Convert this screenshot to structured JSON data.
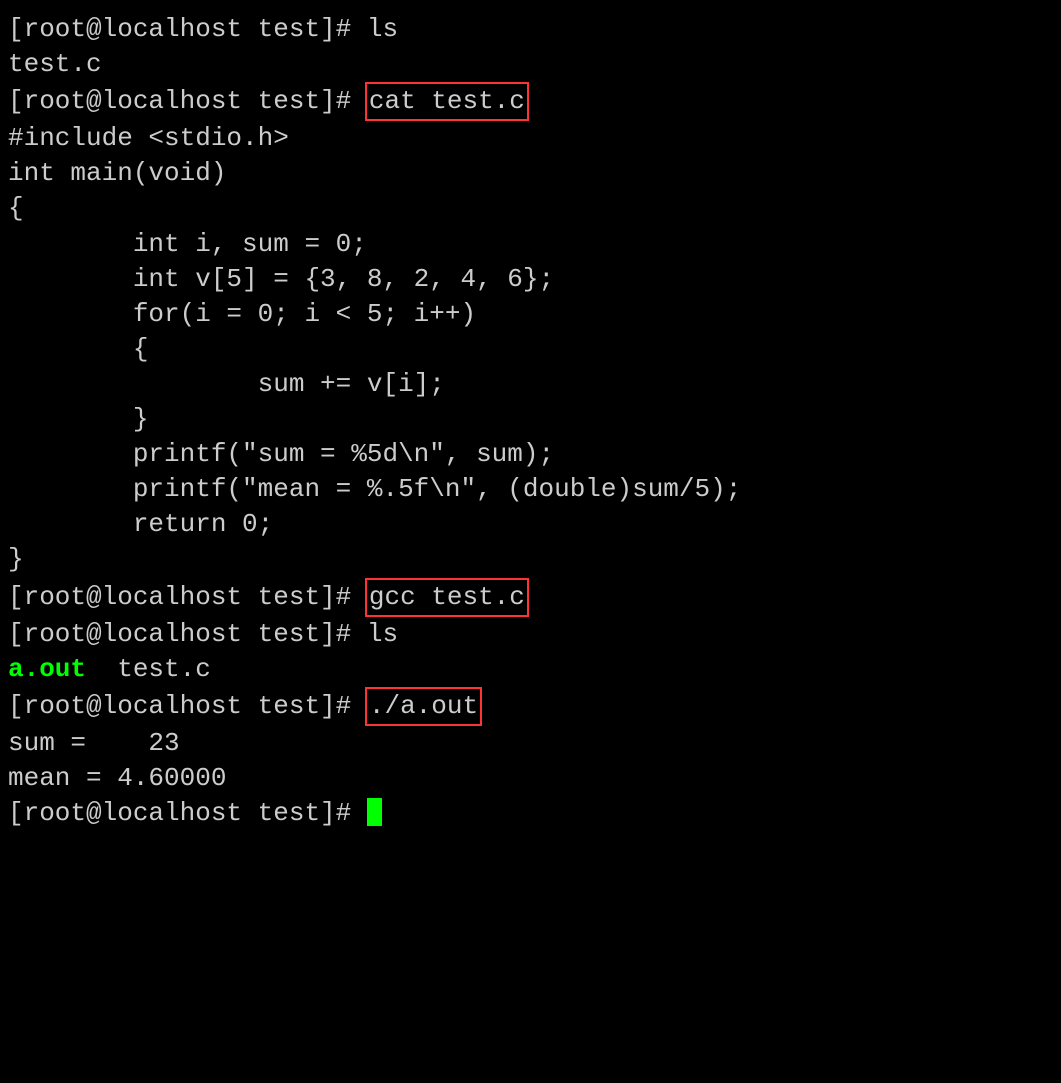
{
  "prompt": "[root@localhost test]# ",
  "cmd": {
    "ls1": "ls",
    "cat": "cat test.c",
    "gcc": "gcc test.c",
    "ls2": "ls",
    "run": "./a.out"
  },
  "ls1_out": "test.c",
  "src": {
    "l1": "#include <stdio.h>",
    "l2": "",
    "l3": "int main(void)",
    "l4": "{",
    "l5": "        int i, sum = 0;",
    "l6": "        int v[5] = {3, 8, 2, 4, 6};",
    "l7": "",
    "l8": "        for(i = 0; i < 5; i++)",
    "l9": "        {",
    "l10": "                sum += v[i];",
    "l11": "        }",
    "l12": "",
    "l13": "        printf(\"sum = %5d\\n\", sum);",
    "l14": "        printf(\"mean = %.5f\\n\", (double)sum/5);",
    "l15": "",
    "l16": "        return 0;",
    "l17": "}"
  },
  "ls2_out": {
    "aout": "a.out",
    "rest": "  test.c"
  },
  "run_out": {
    "sum": "sum =    23",
    "mean": "mean = 4.60000"
  }
}
